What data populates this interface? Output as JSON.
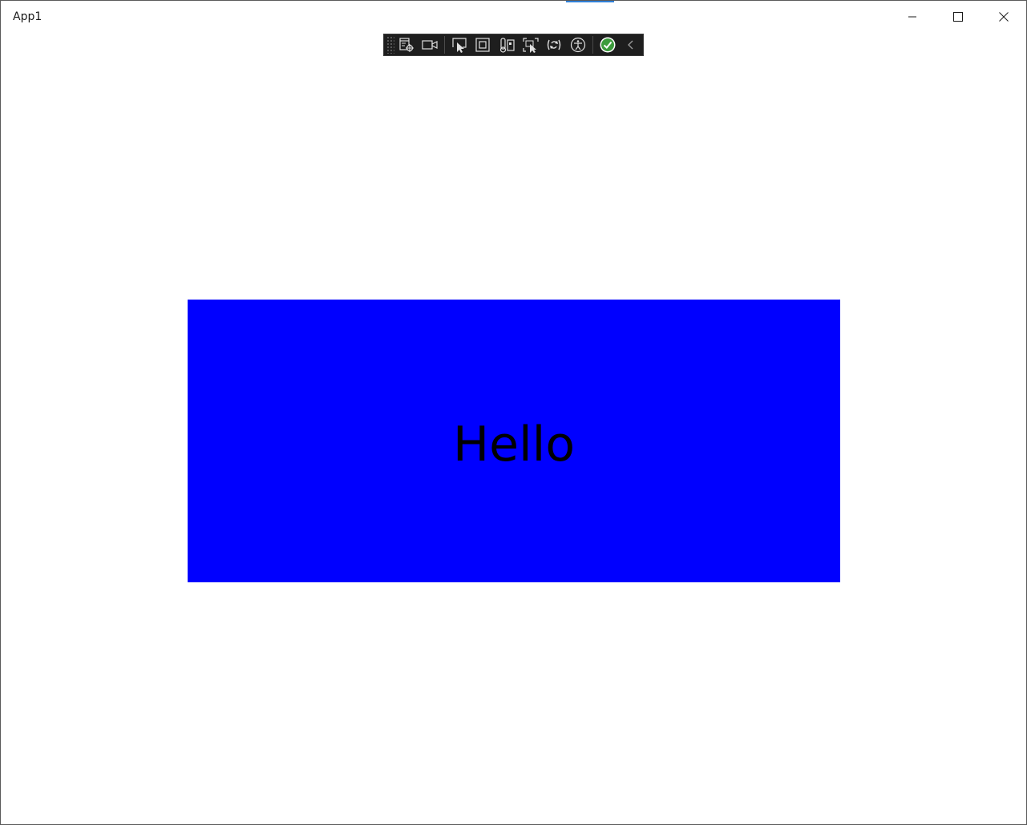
{
  "window": {
    "title": "App1"
  },
  "caption_buttons": {
    "minimize": "minimize-icon",
    "maximize": "maximize-icon",
    "close": "close-icon"
  },
  "debug_toolbar": {
    "icons": [
      "go-to-live-visual-tree-icon",
      "record-icon",
      "select-element-icon",
      "display-layout-adorners-icon",
      "track-focus-icon",
      "select-element-on-hover-icon",
      "hot-reload-icon",
      "accessibility-icon",
      "status-ok-icon",
      "collapse-toolbar-icon"
    ]
  },
  "content": {
    "panel_color": "#0000ff",
    "text": "Hello"
  }
}
